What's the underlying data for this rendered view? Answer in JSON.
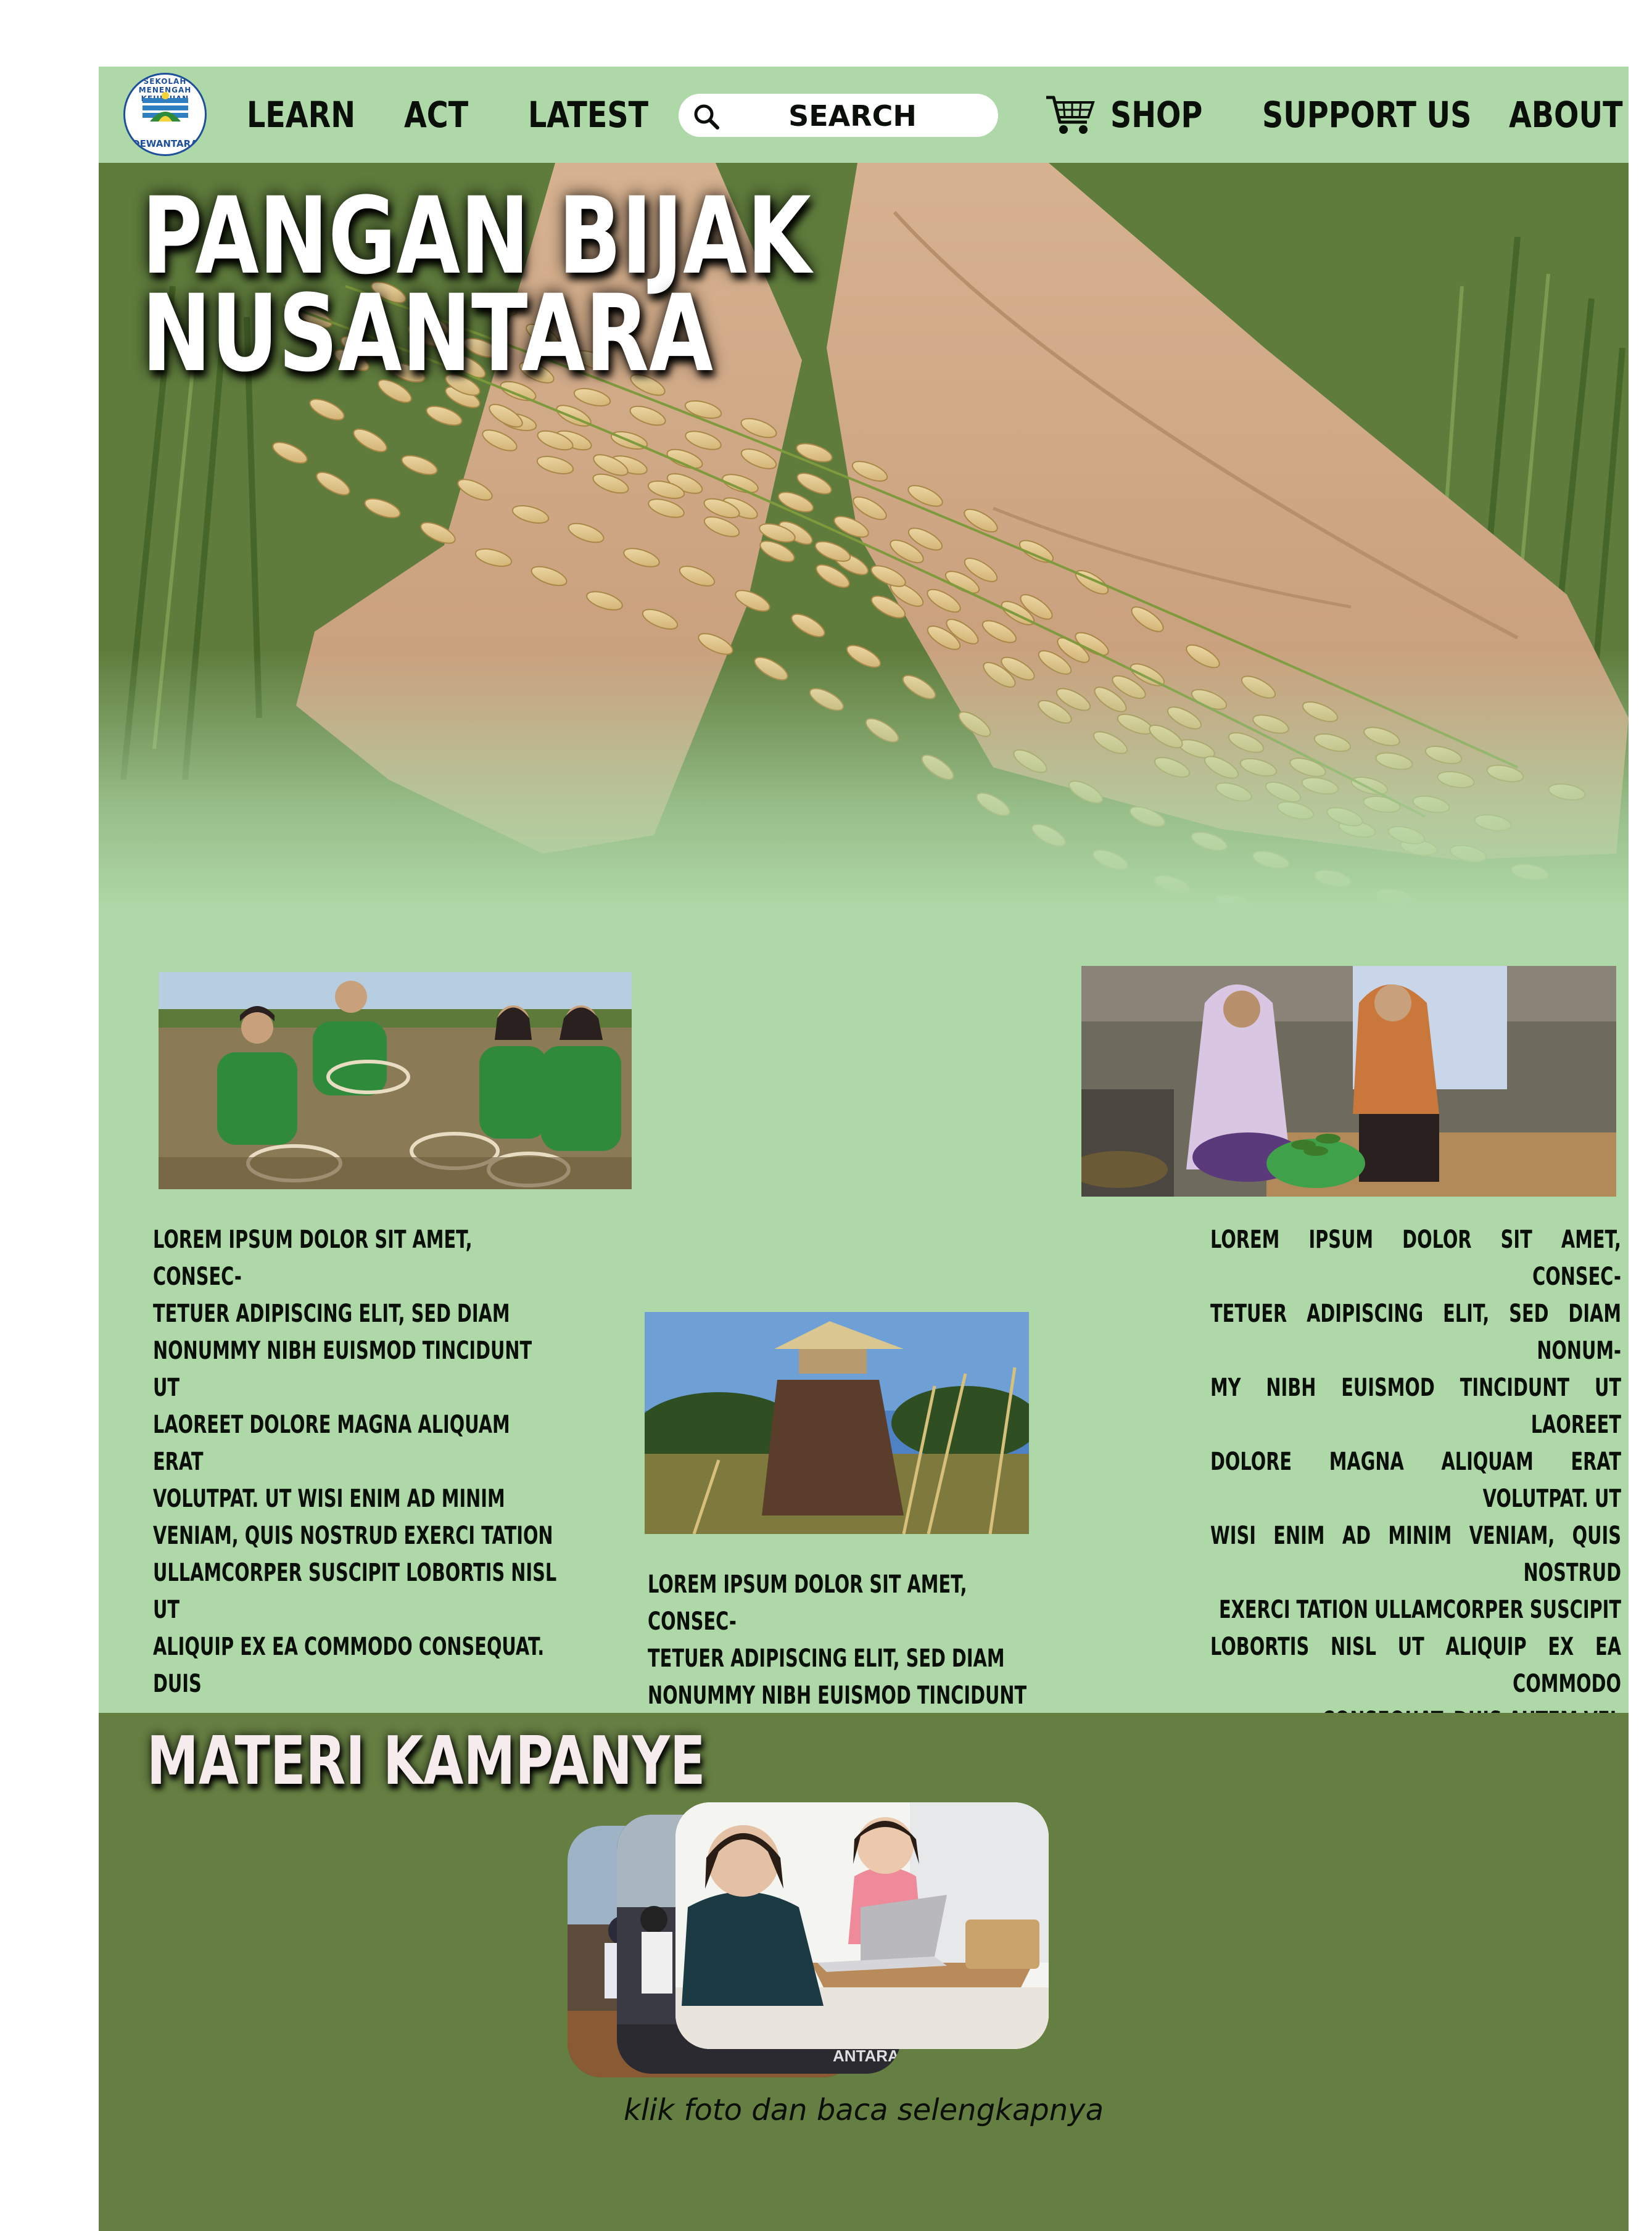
{
  "logo": {
    "arc_text": "SEKOLAH MENENGAH KEJURUAN",
    "bottom_text": "DEWANTARA"
  },
  "nav": {
    "learn": "LEARN",
    "act": "ACT",
    "latest": "LATEST",
    "search_placeholder": "SEARCH",
    "shop": "SHOP",
    "support": "SUPPORT US",
    "about": "ABOUT"
  },
  "hero": {
    "title_line1": "PANGAN BIJAK",
    "title_line2": "NUSANTARA"
  },
  "stories": [
    {
      "text": "LOREM IPSUM DOLOR SIT AMET, CONSEC-\nTETUER ADIPISCING ELIT, SED DIAM\nNONUMMY NIBH EUISMOD TINCIDUNT UT\nLAOREET DOLORE MAGNA ALIQUAM ERAT\nVOLUTPAT. UT WISI ENIM AD MINIM\nVENIAM, QUIS NOSTRUD EXERCI TATION\nULLAMCORPER SUSCIPIT LOBORTIS NISL UT\nALIQUIP EX EA COMMODO CONSEQUAT. DUIS"
    },
    {
      "text": "LOREM IPSUM DOLOR SIT AMET, CONSEC-\nTETUER ADIPISCING ELIT, SED DIAM\nNONUMMY NIBH EUISMOD TINCIDUNT UT"
    },
    {
      "text": "LOREM IPSUM DOLOR SIT AMET, CONSEC-\nTETUER ADIPISCING ELIT, SED DIAM NONUM-\nMY NIBH EUISMOD TINCIDUNT UT LAOREET\nDOLORE MAGNA ALIQUAM ERAT VOLUTPAT. UT\nWISI ENIM AD MINIM VENIAM, QUIS NOSTRUD\nEXERCI TATION ULLAMCORPER SUSCIPIT\nLOBORTIS NISL UT ALIQUIP EX EA COMMODO\nCONSEQUAT. DUIS AUTEM VEL"
    }
  ],
  "materi": {
    "title": "MATERI KAMPANYE",
    "caption": "klik foto dan baca selengkapnya",
    "photo_watermark": "ANTARA"
  },
  "colors": {
    "page_green": "#afd8a8",
    "section_green": "#657e42",
    "text_dark": "#0a0f0a",
    "white": "#ffffff"
  },
  "icons": [
    "logo-emblem",
    "search-icon",
    "cart-icon"
  ]
}
